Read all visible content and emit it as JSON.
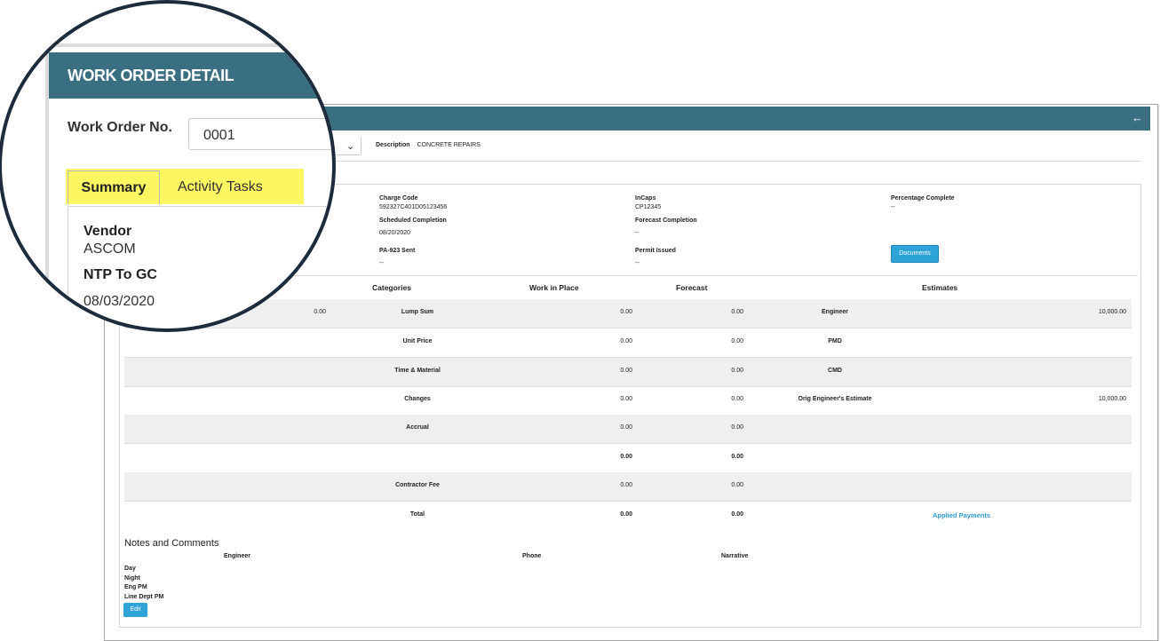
{
  "header": {
    "back_icon": "arrow-left-icon"
  },
  "description": {
    "label": "Description",
    "value": "CONCRETE REPAIRS"
  },
  "fields": {
    "charge_code": {
      "label": "Charge Code",
      "value": "592327C401D05123456"
    },
    "incaps": {
      "label": "InCaps",
      "value": "CP12345"
    },
    "percentage_complete": {
      "label": "Percentage Complete",
      "value": "--"
    },
    "scheduled_completion": {
      "label": "Scheduled Completion",
      "value": "08/20/2020"
    },
    "forecast_completion": {
      "label": "Forecast Completion",
      "value": "--"
    },
    "pa923_sent": {
      "label": "PA-923 Sent",
      "value": "--"
    },
    "permit_issued": {
      "label": "Permit Issued",
      "value": "--"
    }
  },
  "documents_button": "Documents",
  "table": {
    "headers": {
      "categories": "Categories",
      "work_in_place": "Work in Place",
      "forecast": "Forecast",
      "estimates": "Estimates"
    },
    "first_col_value": "0.00",
    "rows": [
      {
        "category": "Lump Sum",
        "wip": "0.00",
        "forecast": "0.00",
        "estimate_label": "Engineer",
        "estimate_value": "10,000.00"
      },
      {
        "category": "Unit Price",
        "wip": "0.00",
        "forecast": "0.00",
        "estimate_label": "PMD",
        "estimate_value": ""
      },
      {
        "category": "Time & Material",
        "wip": "0.00",
        "forecast": "0.00",
        "estimate_label": "CMD",
        "estimate_value": ""
      },
      {
        "category": "Changes",
        "wip": "0.00",
        "forecast": "0.00",
        "estimate_label": "Orig Engineer's Estimate",
        "estimate_value": "10,000.00"
      },
      {
        "category": "Accrual",
        "wip": "0.00",
        "forecast": "0.00",
        "estimate_label": "",
        "estimate_value": ""
      },
      {
        "category": "",
        "wip": "0.00",
        "forecast": "0.00",
        "estimate_label": "",
        "estimate_value": ""
      },
      {
        "category": "Contractor Fee",
        "wip": "0.00",
        "forecast": "0.00",
        "estimate_label": "",
        "estimate_value": ""
      },
      {
        "category": "Total",
        "wip": "0.00",
        "forecast": "0.00",
        "estimate_label": "",
        "estimate_value": ""
      }
    ],
    "applied_payments": "Applied Payments"
  },
  "notes": {
    "title": "Notes and Comments",
    "headers": {
      "engineer": "Engineer",
      "phone": "Phone",
      "narrative": "Narrative"
    },
    "labels": [
      "Day",
      "Night",
      "Eng PM",
      "Line Dept PM"
    ],
    "edit_button": "Edit"
  },
  "magnifier": {
    "title": "WORK ORDER DETAIL",
    "work_order_label": "Work Order No.",
    "work_order_value": "0001",
    "tabs": [
      "Summary",
      "Activity Tasks"
    ],
    "vendor_label": "Vendor",
    "vendor_value": "ASCOM",
    "ntp_label": "NTP To GC",
    "ntp_value": "08/03/2020"
  },
  "colors": {
    "header": "#3a6f82",
    "button": "#2da3d8",
    "highlight": "#fbf662",
    "link": "#2d9bd2"
  }
}
